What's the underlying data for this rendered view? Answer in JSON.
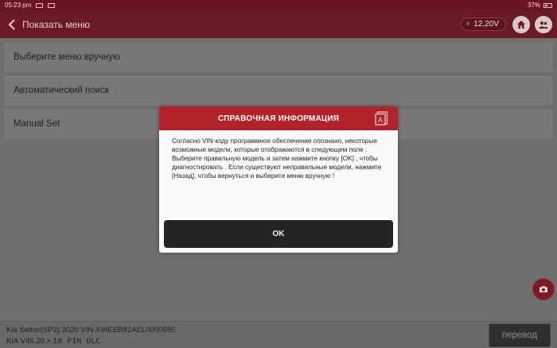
{
  "status_bar": {
    "time": "05:23 pm",
    "battery": "37%"
  },
  "header": {
    "back_icon": "chevron-left-icon",
    "title": "Показать меню",
    "voltage": "12,20V",
    "home_icon": "home-icon",
    "people_icon": "users-icon"
  },
  "menu": {
    "items": [
      {
        "label": "Выберите меню вручную"
      },
      {
        "label": "Автоматический поиск"
      },
      {
        "label": "Manual Set"
      }
    ]
  },
  "dialog": {
    "title": "СПРАВОЧНАЯ ИНФОРМАЦИЯ",
    "icon": "document-icon",
    "paragraph1": "Согласно VIN-коду программное обеспечение опознано, некоторые возможные модели, которые отображаются в следующем поле .",
    "paragraph2": "Выберите правильную модель и затем нажмите кнопку [OK] , чтобы диагностировать . Если существуют неправильные модели, нажмите [Назад], чтобы вернуться и выберите меню вручную !",
    "ok_label": "OK"
  },
  "footer": {
    "vehicle_info": "Kia  Seltos(SP2)  2020  VIN  XWEER81AEL0000595",
    "version_prefix": "KIA V45.20 > ",
    "connector": "16 PIN DLC",
    "action_label": "перевод"
  },
  "colors": {
    "header_bg": "#6b1a23",
    "dialog_header": "#b3212b",
    "ok_button": "#242424"
  }
}
